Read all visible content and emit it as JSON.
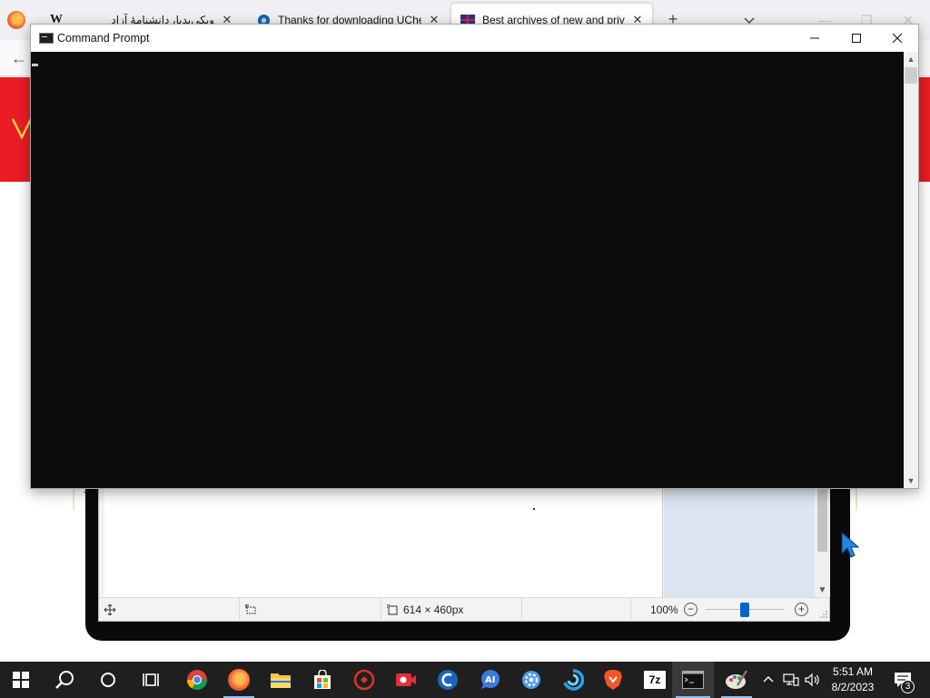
{
  "browser": {
    "tabs": [
      {
        "title": "ویکی‌پدیا، دانشنامهٔ آزاد",
        "favicon": "W",
        "active": false
      },
      {
        "title": "Thanks for downloading UChec",
        "favicon": "gear",
        "active": false
      },
      {
        "title": "Best archives of new and privat",
        "favicon": "flag",
        "active": true
      }
    ],
    "new_tab_label": "+",
    "close_glyph": "✕"
  },
  "cmd": {
    "title": "Command Prompt",
    "colors": {
      "console_bg": "#0c0c0c",
      "cursor": "#cccccc"
    }
  },
  "image_viewer": {
    "status": {
      "image_size": "614 × 460px",
      "zoom": "100%"
    },
    "zoom_level": 0.5
  },
  "taskbar": {
    "apps": [
      {
        "name": "start-button"
      },
      {
        "name": "search-button"
      },
      {
        "name": "cortana-button"
      },
      {
        "name": "task-view-button"
      },
      {
        "name": "chrome-app"
      },
      {
        "name": "firefox-app"
      },
      {
        "name": "file-explorer-app"
      },
      {
        "name": "microsoft-store-app"
      },
      {
        "name": "app-red-circle"
      },
      {
        "name": "screen-recorder-app"
      },
      {
        "name": "ccleaner-app"
      },
      {
        "name": "ai-chat-app"
      },
      {
        "name": "gear-settings-app"
      },
      {
        "name": "blue-swirl-app"
      },
      {
        "name": "brave-app"
      },
      {
        "name": "7zip-app",
        "label": "7z"
      },
      {
        "name": "command-prompt-app"
      },
      {
        "name": "paint-app"
      }
    ],
    "clock": {
      "time": "5:51 AM",
      "date": "8/2/2023"
    },
    "notification_count": "3"
  }
}
